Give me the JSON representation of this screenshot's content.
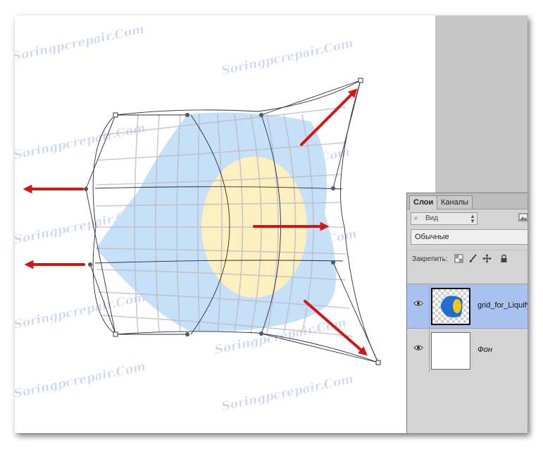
{
  "watermark": "Soringpcrepair.Com",
  "layers_panel": {
    "tabs": [
      {
        "label": "Слои",
        "active": true
      },
      {
        "label": "Каналы",
        "active": false
      }
    ],
    "filter": {
      "icon": "search-icon",
      "label": "Вид"
    },
    "blend_mode": "Обычные",
    "lock_label": "Закрепить:",
    "layers": [
      {
        "name": "grid_for_Liquify",
        "visible": true,
        "selected": true
      },
      {
        "name": "Фон",
        "visible": true,
        "selected": false
      }
    ]
  },
  "colors": {
    "arrow": "#d21515",
    "shape_blue": "#c6e0f7",
    "shape_yellow": "#fcf0c0",
    "pasteboard": "#c6c6c6",
    "panel": "#d4d4d4",
    "selected_layer": "#a9c2f0",
    "watermark": "#c9d3ec"
  }
}
